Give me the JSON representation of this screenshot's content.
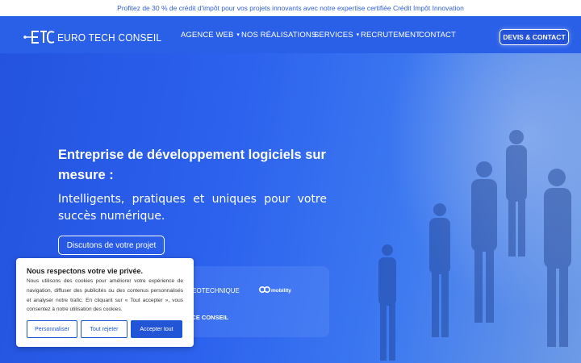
{
  "announcement": {
    "text": "Profitez de 30 % de crédit d'impôt pour vos projets innovants avec notre expertise certifiée Crédit Impôt Innovation"
  },
  "header": {
    "logo_text": "EURO TECH CONSEIL",
    "nav": [
      {
        "label": "AGENCE WEB",
        "has_dropdown": true
      },
      {
        "label": "NOS RÉALISATIONS",
        "has_dropdown": false
      },
      {
        "label": "SERVICES",
        "has_dropdown": true
      },
      {
        "label": "RECRUTEMENT",
        "has_dropdown": false
      },
      {
        "label": "CONTACT",
        "has_dropdown": false
      }
    ],
    "cta_label": "DEVIS & CONTACT"
  },
  "hero": {
    "title": "Entreprise de développement logiciels sur mesure :",
    "subtitle": "Intelligents, pratiques et uniques pour votre succès numérique.",
    "button_label": "Discutons de votre projet",
    "client_logos": [
      {
        "text": "GEOTECHNIQUE"
      },
      {
        "text": "mobility"
      },
      {
        "text": "NCE CONSEIL"
      }
    ]
  },
  "cookie_banner": {
    "title": "Nous respectons votre vie privée.",
    "text": "Nous utilisons des cookies pour améliorer votre expérience de navigation, diffuser des publicités ou des contenus personnalisés et analyser notre trafic. En cliquant sur « Tout accepter », vous consentez à notre utilisation des cookies.",
    "buttons": {
      "customize": "Personnaliser",
      "reject": "Tout rejeter",
      "accept": "Accepter tout"
    }
  },
  "colors": {
    "brand": "#2a5fe8",
    "accent": "#2255d6"
  }
}
